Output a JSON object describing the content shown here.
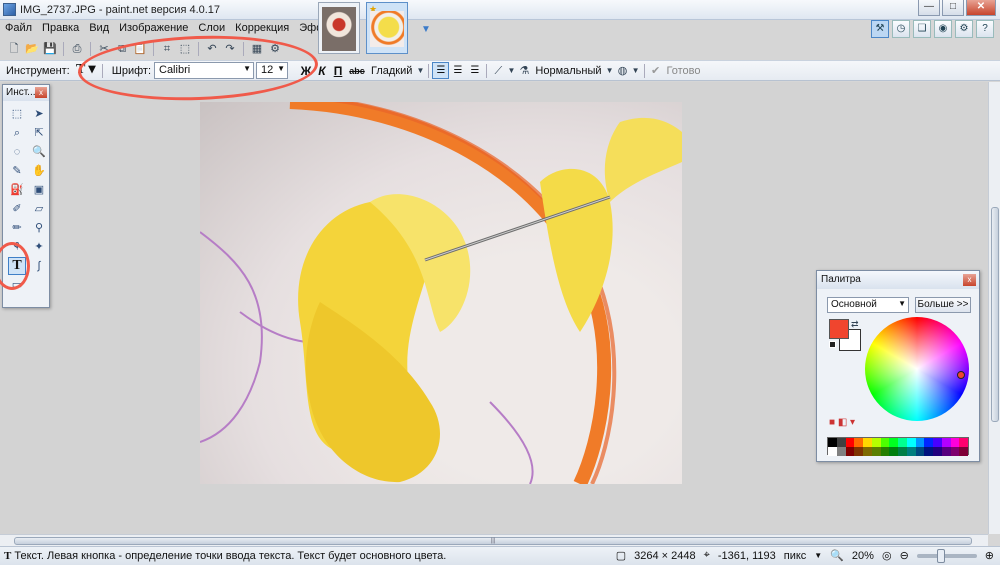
{
  "window": {
    "title": "IMG_2737.JPG - paint.net версия 4.0.17",
    "controls": [
      "—",
      "□",
      "✕"
    ]
  },
  "menu": [
    "Файл",
    "Правка",
    "Вид",
    "Изображение",
    "Слои",
    "Коррекция",
    "Эффекты"
  ],
  "text_toolbar": {
    "tool_label": "Инструмент:",
    "font_label": "Шрифт:",
    "font_value": "Calibri",
    "size_value": "12",
    "bold": "Ж",
    "italic": "К",
    "underline": "П",
    "strike": "abc",
    "rendering": "Гладкий",
    "blend_mode": "Нормальный",
    "finish": "Готово"
  },
  "tools_window": {
    "title": "Инст..."
  },
  "palette_window": {
    "title": "Палитра",
    "mode": "Основной",
    "more_button": "Больше >>",
    "primary_color": "#f0452e",
    "secondary_color": "#ffffff",
    "swatches_row1": [
      "#000000",
      "#404040",
      "#ff0000",
      "#ff6a00",
      "#ffd800",
      "#b6ff00",
      "#4cff00",
      "#00ff21",
      "#00ff90",
      "#00ffff",
      "#0094ff",
      "#0026ff",
      "#4800ff",
      "#b200ff",
      "#ff00dc",
      "#ff006e"
    ],
    "swatches_row2": [
      "#ffffff",
      "#808080",
      "#7f0000",
      "#7f3300",
      "#7f6a00",
      "#5b7f00",
      "#267f00",
      "#007f0e",
      "#007f46",
      "#007f7f",
      "#004a7f",
      "#00137f",
      "#21007f",
      "#57007f",
      "#7f006e",
      "#7f0037"
    ]
  },
  "status": {
    "hint": "Текст. Левая кнопка - определение точки ввода текста. Текст будет основного цвета.",
    "image_size": "3264 × 2448",
    "cursor_pos": "-1361, 1193",
    "units": "пикс",
    "zoom": "20%"
  },
  "annotations_color": "#f05a4a"
}
